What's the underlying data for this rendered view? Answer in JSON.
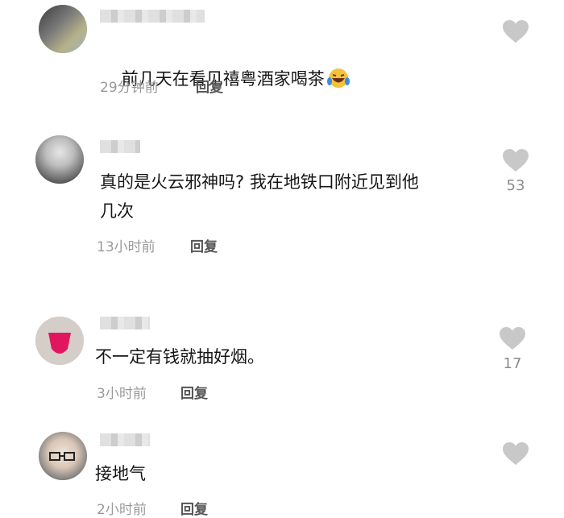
{
  "comments": [
    {
      "text": "前几天在看见禧粤酒家喝茶",
      "emoji": "laughing-crying-face",
      "time": "29分钟前",
      "reply": "回复",
      "likes": ""
    },
    {
      "text": "真的是火云邪神吗? 我在地铁口附近见到他\n几次",
      "time": "13小时前",
      "reply": "回复",
      "likes": "53"
    },
    {
      "text": "不一定有钱就抽好烟。",
      "time": "3小时前",
      "reply": "回复",
      "likes": "17"
    },
    {
      "text": "接地气",
      "time": "2小时前",
      "reply": "回复",
      "likes": ""
    }
  ],
  "colors": {
    "heart": "#c8c8c8",
    "text": "#161616",
    "meta": "#9a9a9a"
  }
}
